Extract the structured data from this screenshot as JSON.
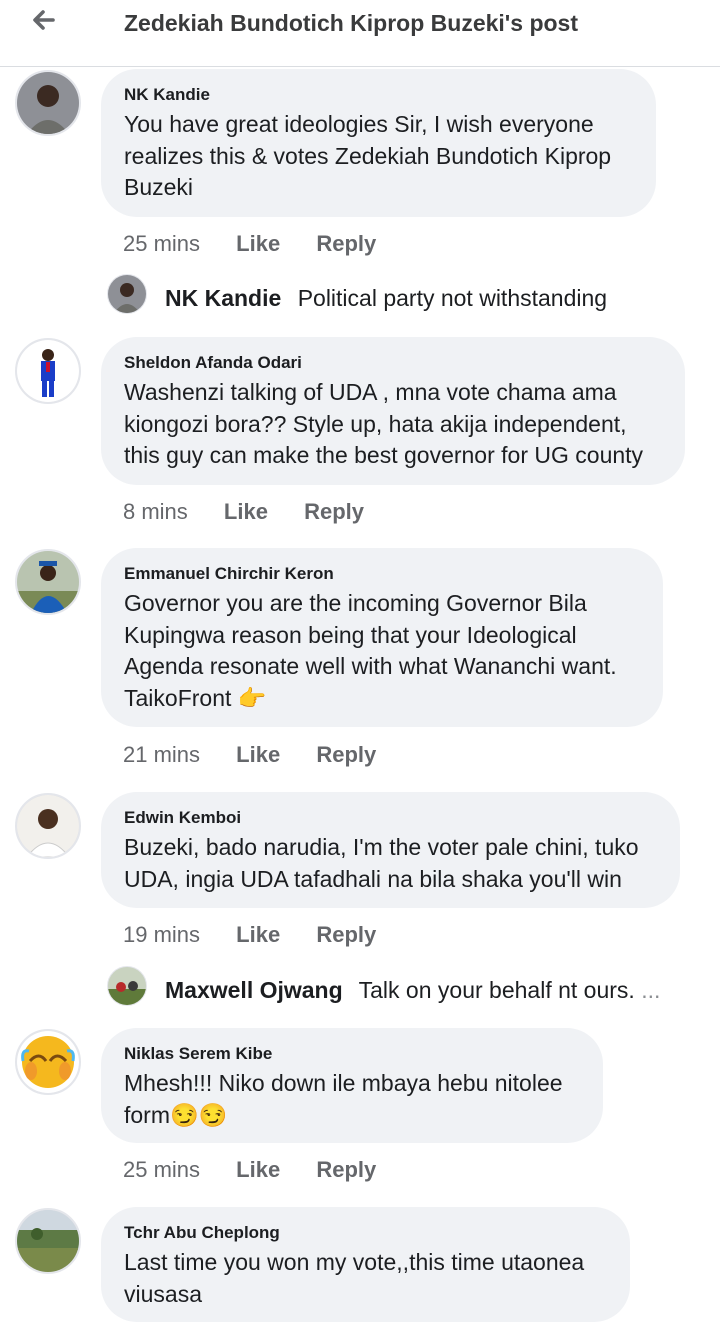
{
  "header": {
    "title": "Zedekiah Bundotich Kiprop Buzeki's post",
    "back_icon": "arrow-left-icon"
  },
  "actions": {
    "like": "Like",
    "reply": "Reply"
  },
  "comments": [
    {
      "author": "NK Kandie",
      "text": "You have great ideologies Sir, I wish everyone\nrealizes this & votes Zedekiah Bundotich Kiprop\nBuzeki",
      "time": "25 mins"
    },
    {
      "author": "Sheldon Afanda Odari",
      "text": "Washenzi talking of UDA , mna vote chama ama\nkiongozi bora?? Style up, hata akija independent,\nthis guy can make the best governor for UG county",
      "time": "8 mins"
    },
    {
      "author": "Emmanuel Chirchir Keron",
      "text": "Governor you are the incoming Governor Bila\nKupingwa reason being  that your Ideological\nAgenda resonate well with what Wananchi want.\nTaikoFront 👉",
      "time": "21 mins"
    },
    {
      "author": "Edwin Kemboi",
      "text": "Buzeki, bado narudia, I'm the voter pale chini, tuko\nUDA, ingia UDA tafadhali na bila shaka you'll win",
      "time": "19 mins"
    },
    {
      "author": "Niklas Serem Kibe",
      "text": "Mhesh!!! Niko down ile mbaya hebu nitolee\nform😏😏",
      "time": "25 mins"
    },
    {
      "author": "Tchr Abu Cheplong",
      "text": "Last time you won my vote,,this time utaonea\nviusasa"
    }
  ],
  "replies": [
    {
      "author": "NK Kandie",
      "text": "Political party not withstanding"
    },
    {
      "author": "Maxwell Ojwang",
      "text": "Talk on your behalf nt ours.",
      "more": "..."
    }
  ]
}
